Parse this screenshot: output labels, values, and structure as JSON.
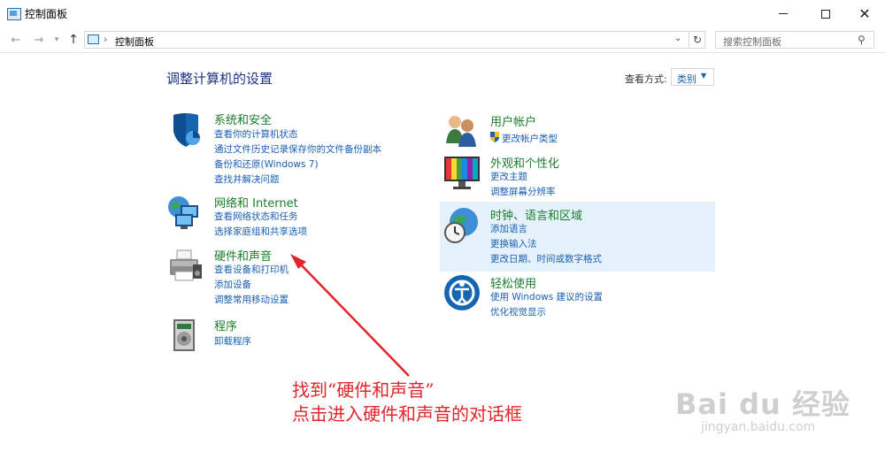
{
  "window": {
    "title": "控制面板",
    "controls": {
      "minimize": "minimize-icon",
      "maximize": "maximize-icon",
      "close": "close-icon"
    }
  },
  "address_bar": {
    "breadcrumb": [
      "控制面板"
    ],
    "search_placeholder": "搜索控制面板"
  },
  "main": {
    "heading": "调整计算机的设置",
    "view_by": {
      "label": "查看方式:",
      "value": "类别"
    },
    "categories_left": [
      {
        "title": "系统和安全",
        "icon": "shield-icon",
        "links": [
          "查看你的计算机状态",
          "通过文件历史记录保存你的文件备份副本",
          "备份和还原(Windows 7)",
          "查找并解决问题"
        ]
      },
      {
        "title": "网络和 Internet",
        "icon": "network-globe-icon",
        "links": [
          "查看网络状态和任务",
          "选择家庭组和共享选项"
        ]
      },
      {
        "title": "硬件和声音",
        "icon": "printer-icon",
        "links": [
          "查看设备和打印机",
          "添加设备",
          "调整常用移动设置"
        ]
      },
      {
        "title": "程序",
        "icon": "programs-icon",
        "links": [
          "卸载程序"
        ]
      }
    ],
    "categories_right": [
      {
        "title": "用户帐户",
        "icon": "users-icon",
        "links": [
          "更改帐户类型"
        ]
      },
      {
        "title": "外观和个性化",
        "icon": "monitor-icon",
        "links": [
          "更改主题",
          "调整屏幕分辨率"
        ]
      },
      {
        "title": "时钟、语言和区域",
        "icon": "clock-globe-icon",
        "links": [
          "添加语言",
          "更换输入法",
          "更改日期、时间或数字格式"
        ]
      },
      {
        "title": "轻松使用",
        "icon": "ease-of-access-icon",
        "links": [
          "使用 Windows 建议的设置",
          "优化视觉显示"
        ]
      }
    ]
  },
  "annotation": {
    "line1": "找到“硬件和声音”",
    "line2": "点击进入硬件和声音的对话框",
    "color": "#e3242b"
  },
  "watermark": {
    "brand": "Bai du 经验",
    "url": "jingyan.baidu.com"
  },
  "colors": {
    "category_title": "#1a7d2c",
    "link": "#1a5fb4",
    "heading": "#1e3287",
    "highlight": "#e5f1fb"
  }
}
